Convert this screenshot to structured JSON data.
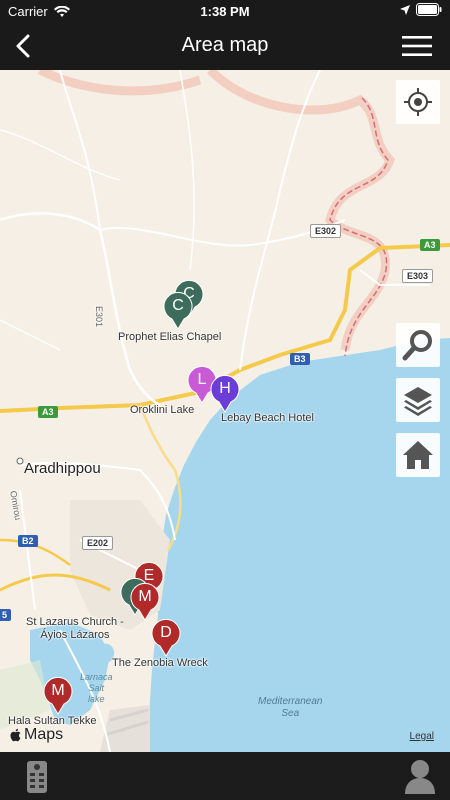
{
  "status_bar": {
    "carrier": "Carrier",
    "time": "1:38 PM"
  },
  "nav": {
    "title": "Area map"
  },
  "map": {
    "places": {
      "prophet_elias": "Prophet Elias Chapel",
      "oroklini_lake": "Oroklini Lake",
      "lebay": "Lebay Beach Hotel",
      "aradhippou": "Aradhippou",
      "st_lazarus": "St Lazarus Church -\nÁyios Lázaros",
      "zenobia": "The Zenobia Wreck",
      "hala_sultan": "Hala Sultan Tekke",
      "larnaca_salt_lake": "Larnaca\nSalt\nlake",
      "med_sea": "Mediterranean\nSea",
      "omirou": "Omirou"
    },
    "roads": {
      "e302": "E302",
      "a3_right": "A3",
      "e303": "E303",
      "e301": "E301",
      "b3": "B3",
      "a3_left": "A3",
      "b2": "B2",
      "e202": "E202",
      "b_left": "5"
    },
    "pins": [
      {
        "letter": "C",
        "color": "#3d6b5c"
      },
      {
        "letter": "C",
        "color": "#3d6b5c"
      },
      {
        "letter": "L",
        "color": "#c85ad6"
      },
      {
        "letter": "H",
        "color": "#6a3ed6"
      },
      {
        "letter": "E",
        "color": "#b02a2a"
      },
      {
        "letter": "",
        "color": "#3d6b5c"
      },
      {
        "letter": "M",
        "color": "#b02a2a"
      },
      {
        "letter": "D",
        "color": "#b02a2a"
      },
      {
        "letter": "M",
        "color": "#b02a2a"
      }
    ],
    "maps_label": "Maps",
    "legal_label": "Legal"
  },
  "colors": {
    "sea": "#a5d6ee",
    "land": "#f6efe5",
    "bar": "#1a1a1a",
    "highway": "#f5c94a"
  },
  "icons": [
    "back-icon",
    "menu-icon",
    "locate-icon",
    "search-icon",
    "layers-icon",
    "home-icon",
    "remote-icon",
    "user-icon",
    "wifi-icon",
    "battery-icon",
    "location-arrow-icon"
  ]
}
